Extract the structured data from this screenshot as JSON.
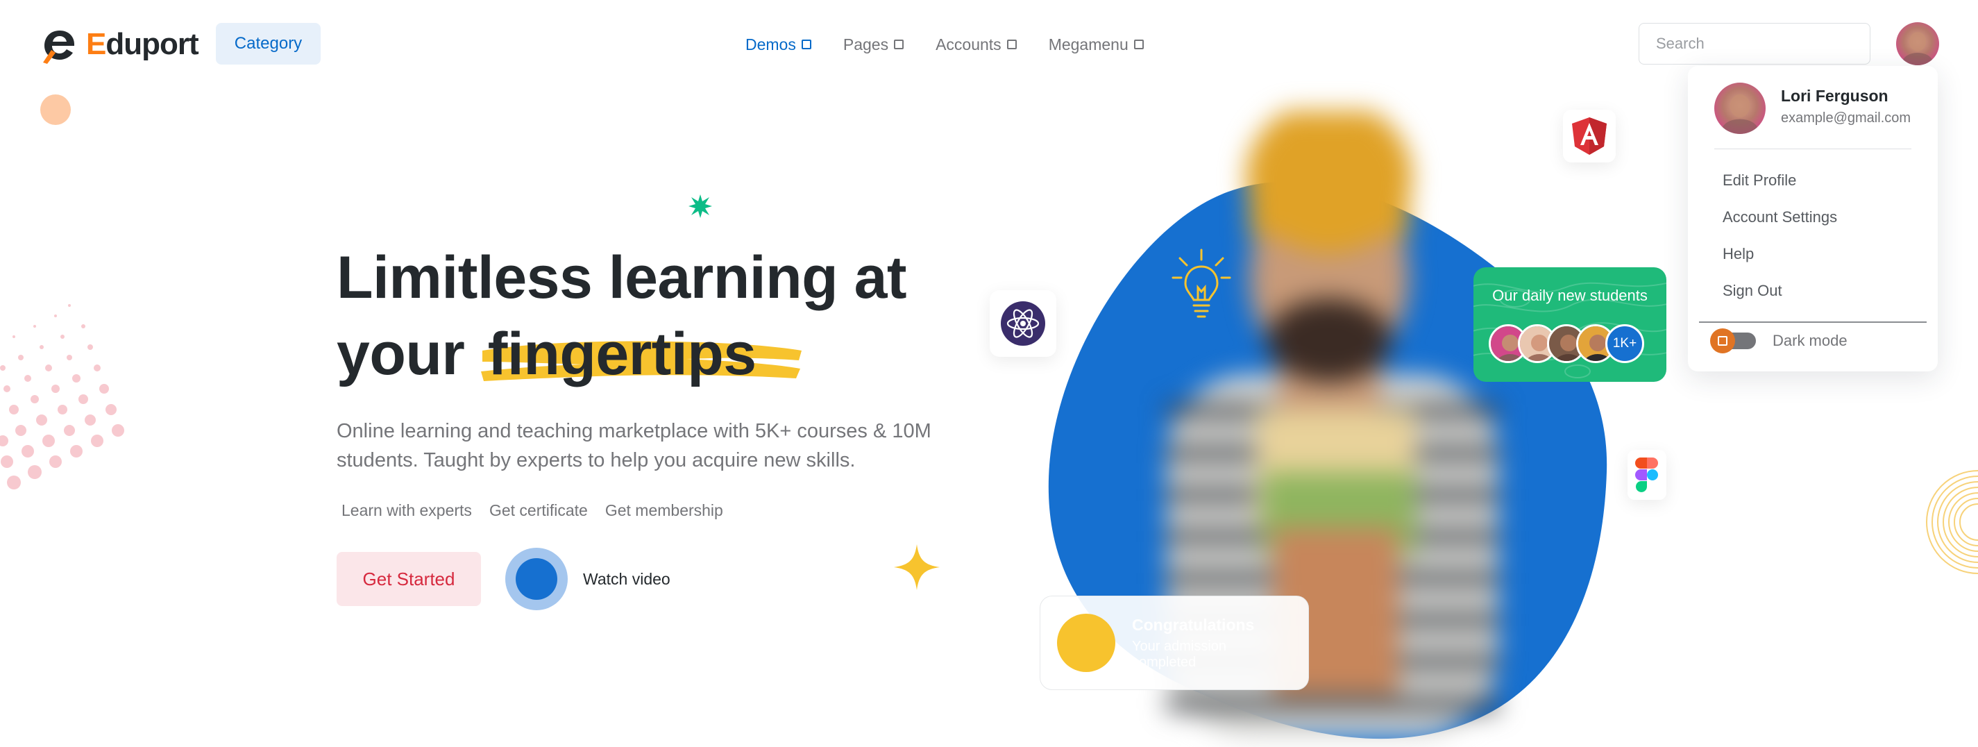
{
  "brand": {
    "name_first": "E",
    "name_rest": "duport",
    "accent": "#fd7e14"
  },
  "header": {
    "category_label": "Category",
    "nav": [
      {
        "label": "Demos",
        "active": true
      },
      {
        "label": "Pages",
        "active": false
      },
      {
        "label": "Accounts",
        "active": false
      },
      {
        "label": "Megamenu",
        "active": false
      }
    ],
    "search_placeholder": "Search"
  },
  "hero": {
    "title_line1": "Limitless learning at",
    "title_line2_prefix": "your",
    "title_highlight": "fingertips",
    "subtitle": "Online learning and teaching marketplace with 5K+ courses & 10M students. Taught by experts to help you acquire new skills.",
    "features": [
      "Learn with experts",
      "Get certificate",
      "Get membership"
    ],
    "cta_label": "Get Started",
    "watch_label": "Watch video"
  },
  "students_card": {
    "title": "Our daily new students",
    "count": "1K+"
  },
  "congrats_card": {
    "title": "Congratulations",
    "subtitle": "Your admission completed"
  },
  "user_menu": {
    "name": "Lori Ferguson",
    "email": "example@gmail.com",
    "items": [
      "Edit Profile",
      "Account Settings",
      "Help",
      "Sign Out"
    ],
    "dark_mode_label": "Dark mode"
  },
  "colors": {
    "primary": "#066ac9",
    "blob": "#1670d0",
    "success": "#1fba7a",
    "warning": "#f7c32e",
    "danger": "#d6293e"
  },
  "icons": [
    "logo-mark-icon",
    "caret-icon",
    "react-icon",
    "angular-icon",
    "figma-icon",
    "bulb-icon",
    "star-icon",
    "play-icon"
  ]
}
